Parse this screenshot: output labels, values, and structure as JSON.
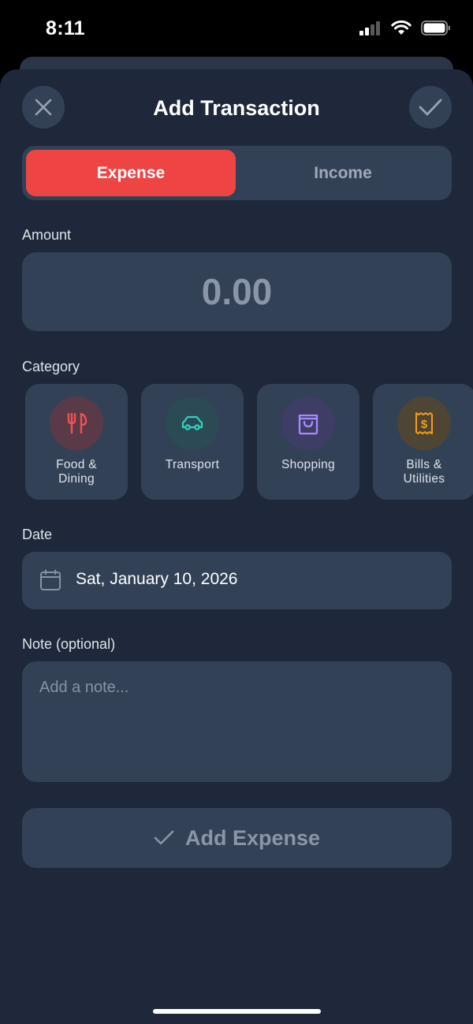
{
  "status_bar": {
    "time": "8:11"
  },
  "header": {
    "title": "Add Transaction"
  },
  "type_toggle": {
    "expense_label": "Expense",
    "income_label": "Income",
    "selected": "Expense"
  },
  "amount": {
    "label": "Amount",
    "value": "0.00"
  },
  "category": {
    "label": "Category",
    "items": [
      {
        "label": "Food &\nDining",
        "icon": "fork-knife-icon",
        "color": "#ef5350",
        "bg": "#5a3a48"
      },
      {
        "label": "Transport",
        "icon": "car-icon",
        "color": "#2dd4bf",
        "bg": "#2b4a55"
      },
      {
        "label": "Shopping",
        "icon": "shopping-bag-icon",
        "color": "#a78bfa",
        "bg": "#3e3d66"
      },
      {
        "label": "Bills &\nUtilities",
        "icon": "receipt-icon",
        "color": "#f59e0b",
        "bg": "#4e4535"
      }
    ]
  },
  "date": {
    "label": "Date",
    "value": "Sat, January 10, 2026"
  },
  "note": {
    "label": "Note (optional)",
    "placeholder": "Add a note..."
  },
  "submit": {
    "label": "Add Expense"
  },
  "colors": {
    "accent_expense": "#ef4444",
    "sheet_bg": "#1e283a",
    "card_bg": "#334157"
  }
}
